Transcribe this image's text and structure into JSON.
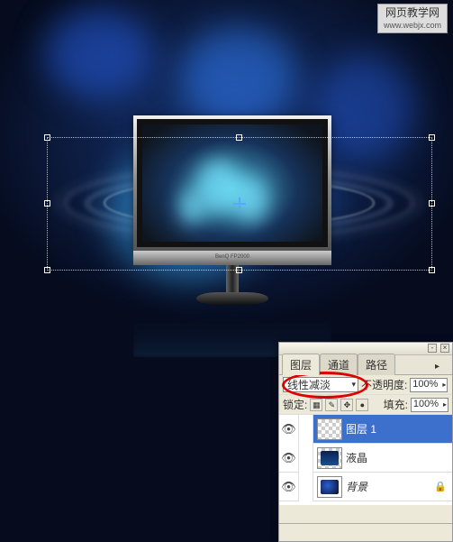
{
  "watermark": {
    "title": "网页教学网",
    "url": "www.webjx.com"
  },
  "monitor": {
    "brand": "BenQ FP2000"
  },
  "panel": {
    "tabs": [
      {
        "label": "图层",
        "active": true
      },
      {
        "label": "通道",
        "active": false
      },
      {
        "label": "路径",
        "active": false
      }
    ],
    "blend_mode": "线性减淡",
    "opacity_label": "不透明度:",
    "opacity_value": "100%",
    "lock_label": "锁定:",
    "fill_label": "填充:",
    "fill_value": "100%",
    "layers": [
      {
        "name": "图层 1",
        "visible": true,
        "selected": true,
        "thumb": "checker"
      },
      {
        "name": "液晶",
        "visible": true,
        "selected": false,
        "thumb": "monitor"
      },
      {
        "name": "背景",
        "visible": true,
        "selected": false,
        "thumb": "bg",
        "locked": true
      }
    ]
  }
}
